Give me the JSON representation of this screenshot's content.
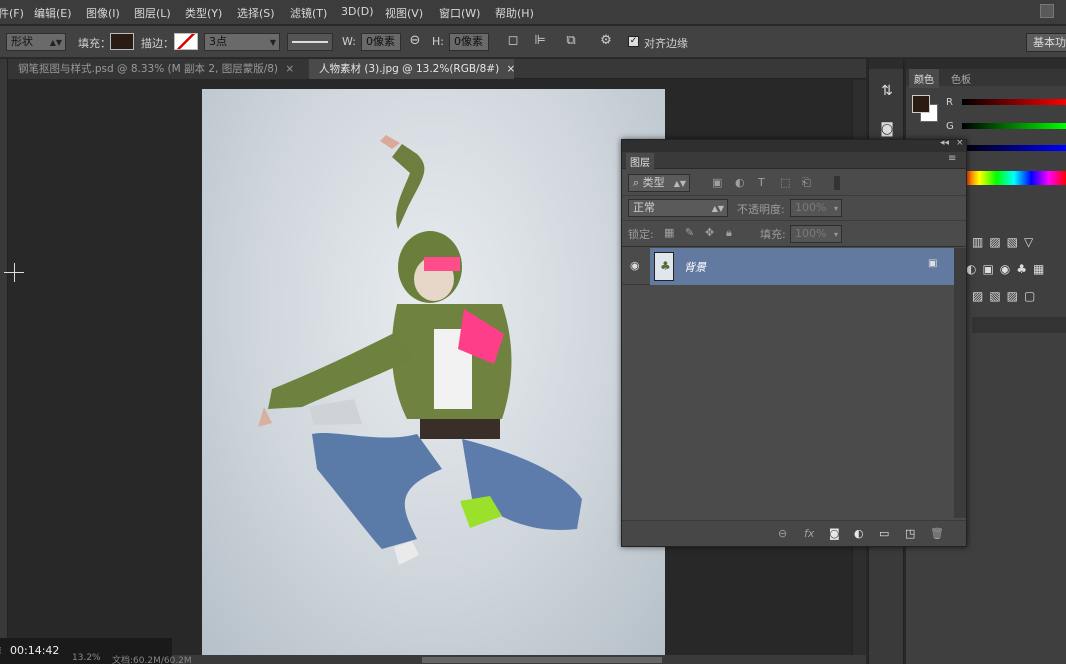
{
  "menu": [
    "件(F)",
    "编辑(E)",
    "图像(I)",
    "图层(L)",
    "类型(Y)",
    "选择(S)",
    "滤镜(T)",
    "3D(D)",
    "视图(V)",
    "窗口(W)",
    "帮助(H)"
  ],
  "options": {
    "tool_mode": "形状",
    "fill_label": "填充：",
    "stroke_label": "描边：",
    "stroke_width": "3点",
    "w_label": "W:",
    "w_value": "0像素",
    "h_label": "H:",
    "h_value": "0像素",
    "align_edges": "对齐边缘",
    "workspace": "基本功",
    "fill_color": "#2a1c12"
  },
  "tabs": [
    {
      "label": "钢笔抠图与样式.psd @ 8.33% (M 副本 2, 图层蒙版/8)",
      "close": "×"
    },
    {
      "label": "人物素材 (3).jpg @ 13.2%(RGB/8#)",
      "close": "×"
    }
  ],
  "right_panel": {
    "tabs": [
      "颜色",
      "色板"
    ],
    "r_label": "R",
    "g_label": "G"
  },
  "layers_panel": {
    "title": "图层",
    "filter_kind": "类型",
    "blend_mode": "正常",
    "opacity_label": "不透明度:",
    "opacity_value": "100%",
    "lock_label": "锁定:",
    "fill_label": "填充:",
    "fill_value": "100%",
    "layer_name": "背景"
  },
  "status": {
    "time": "00:14:42",
    "zoom": "13.2%",
    "doc": "文档:60.2M/60.2M"
  }
}
